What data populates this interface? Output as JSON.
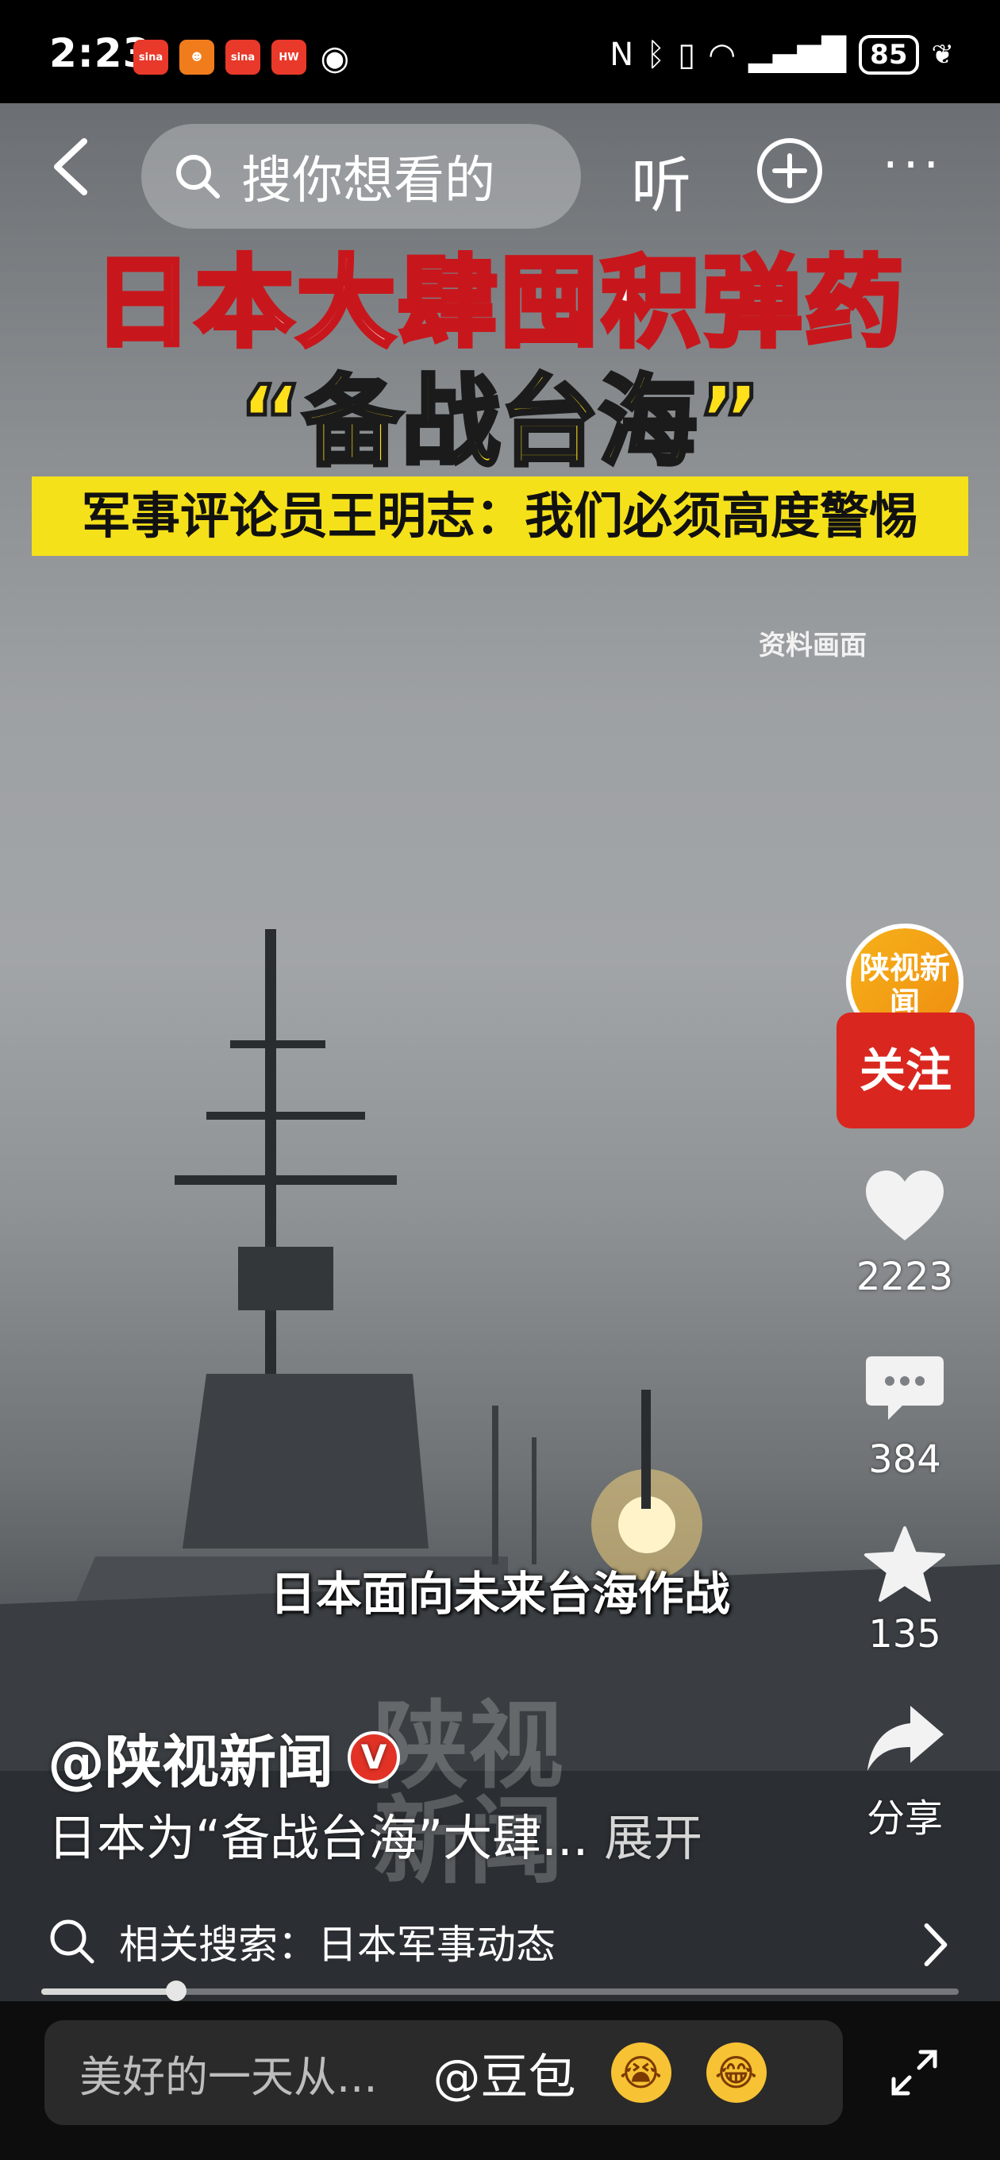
{
  "status_bar": {
    "time": "2:23",
    "battery": "85",
    "app_icons": [
      "sina",
      "taobao",
      "sina",
      "huawei"
    ]
  },
  "top_bar": {
    "search_placeholder": "搜你想看的",
    "listen_label": "听"
  },
  "video": {
    "headline_line1": "日本大肆囤积弹药",
    "headline_line2": "“备战台海”",
    "headline_line3": "军事评论员王明志：我们必须高度警惕",
    "stock_footage_label": "资料画面",
    "subtitle": "日本面向未来台海作战",
    "watermark": "陕视新闻"
  },
  "right_rail": {
    "avatar_text": "陕视新闻",
    "follow_label": "关注",
    "likes": "2223",
    "comments": "384",
    "favorites": "135",
    "share_label": "分享"
  },
  "info": {
    "author": "@陕视新闻",
    "verified_badge": "V",
    "description": "日本为“备战台海”大肆...",
    "expand_label": "展开"
  },
  "related_search": {
    "label": "相关搜索：日本军事动态"
  },
  "progress": {
    "played_fraction": 0.147
  },
  "comment_bar": {
    "placeholder": "美好的一天从...",
    "mention": "@豆包"
  }
}
